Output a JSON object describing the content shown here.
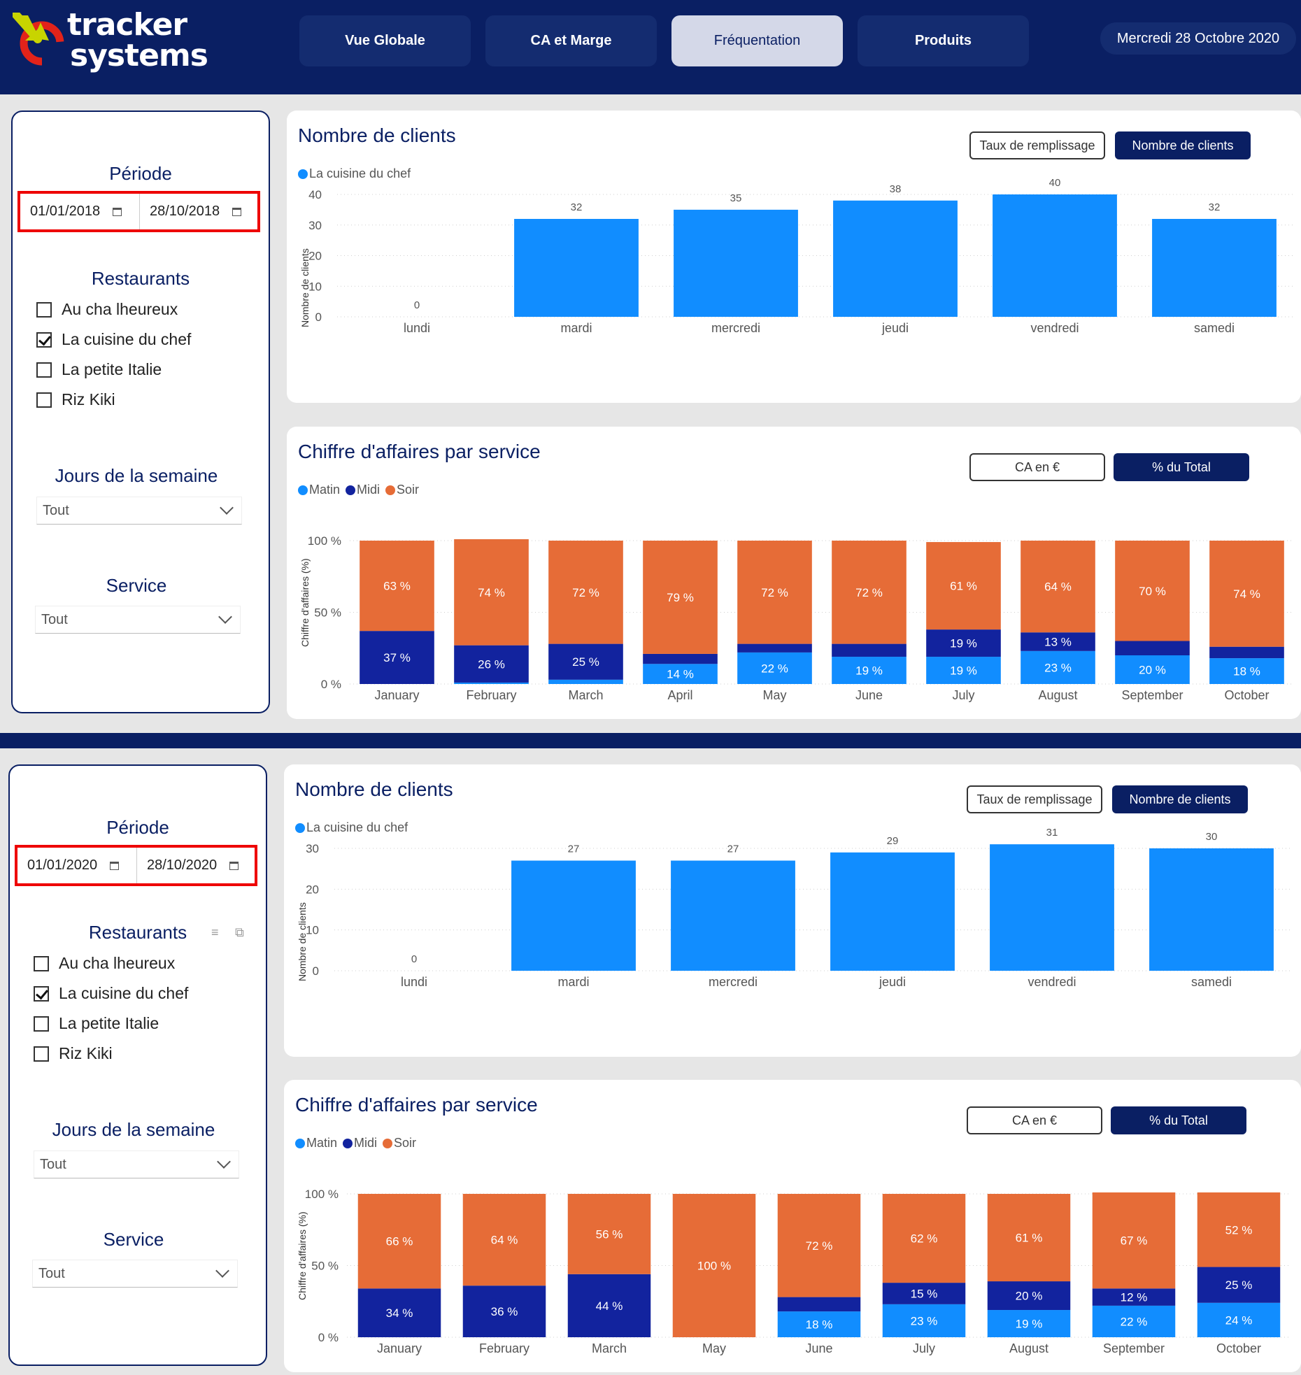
{
  "header": {
    "logo_line1": "tracker",
    "logo_line2": "systems",
    "tabs": [
      {
        "label": "Vue Globale",
        "active": false
      },
      {
        "label": "CA et Marge",
        "active": false
      },
      {
        "label": "Fréquentation",
        "active": true
      },
      {
        "label": "Produits",
        "active": false
      }
    ],
    "date": "Mercredi 28 Octobre 2020"
  },
  "colors": {
    "navy": "#0a1f63",
    "matin": "#118dff",
    "midi": "#12239e",
    "soir": "#e66c37",
    "highlight": "#ee0000"
  },
  "views": [
    {
      "filters": {
        "periode_title": "Période",
        "date_start": "01/01/2018",
        "date_end": "28/10/2018",
        "restaurants_title": "Restaurants",
        "restaurants": [
          {
            "label": "Au cha lheureux",
            "checked": false
          },
          {
            "label": "La cuisine du chef",
            "checked": true
          },
          {
            "label": "La petite Italie",
            "checked": false
          },
          {
            "label": "Riz Kiki",
            "checked": false
          }
        ],
        "jours_title": "Jours de la semaine",
        "jours_value": "Tout",
        "service_title": "Service",
        "service_value": "Tout"
      },
      "clients_panel": {
        "title": "Nombre de clients",
        "btn_taux": "Taux de remplissage",
        "btn_nombre": "Nombre de clients",
        "legend": "La cuisine du chef",
        "ylabel": "Nombre de clients"
      },
      "ca_panel": {
        "title": "Chiffre d'affaires par service",
        "btn_ca": "CA en €",
        "btn_pct": "% du Total",
        "legend": [
          "Matin",
          "Midi",
          "Soir"
        ],
        "ylabel": "Chiffre d'affaires (%)"
      }
    },
    {
      "filters": {
        "periode_title": "Période",
        "date_start": "01/01/2020",
        "date_end": "28/10/2020",
        "restaurants_title": "Restaurants",
        "restaurants": [
          {
            "label": "Au cha lheureux",
            "checked": false
          },
          {
            "label": "La cuisine du chef",
            "checked": true
          },
          {
            "label": "La petite Italie",
            "checked": false
          },
          {
            "label": "Riz Kiki",
            "checked": false
          }
        ],
        "jours_title": "Jours de la semaine",
        "jours_value": "Tout",
        "service_title": "Service",
        "service_value": "Tout"
      },
      "clients_panel": {
        "title": "Nombre de clients",
        "btn_taux": "Taux de remplissage",
        "btn_nombre": "Nombre de clients",
        "legend": "La cuisine du chef",
        "ylabel": "Nombre de clients"
      },
      "ca_panel": {
        "title": "Chiffre d'affaires par service",
        "btn_ca": "CA en €",
        "btn_pct": "% du Total",
        "legend": [
          "Matin",
          "Midi",
          "Soir"
        ],
        "ylabel": "Chiffre d'affaires (%)"
      }
    }
  ],
  "chart_data": [
    {
      "type": "bar",
      "title": "Nombre de clients",
      "ylabel": "Nombre de clients",
      "categories": [
        "lundi",
        "mardi",
        "mercredi",
        "jeudi",
        "vendredi",
        "samedi"
      ],
      "series": [
        {
          "name": "La cuisine du chef",
          "values": [
            0,
            32,
            35,
            38,
            40,
            32
          ]
        }
      ],
      "ylim": [
        0,
        40
      ],
      "yticks": [
        0,
        10,
        20,
        30,
        40
      ]
    },
    {
      "type": "bar",
      "stacked": true,
      "title": "Chiffre d'affaires par service",
      "ylabel": "Chiffre d'affaires (%)",
      "categories": [
        "January",
        "February",
        "March",
        "April",
        "May",
        "June",
        "July",
        "August",
        "September",
        "October"
      ],
      "series": [
        {
          "name": "Matin",
          "values": [
            0,
            1,
            3,
            14,
            22,
            19,
            19,
            23,
            20,
            18
          ]
        },
        {
          "name": "Midi",
          "values": [
            37,
            26,
            25,
            7,
            6,
            9,
            19,
            13,
            10,
            8
          ]
        },
        {
          "name": "Soir",
          "values": [
            63,
            74,
            72,
            79,
            72,
            72,
            61,
            64,
            70,
            74
          ]
        }
      ],
      "labels": {
        "Matin": [
          "",
          "",
          "",
          "14 %",
          "22 %",
          "19 %",
          "19 %",
          "23 %",
          "20 %",
          "18 %"
        ],
        "Midi": [
          "37 %",
          "26 %",
          "25 %",
          "",
          "",
          "",
          "19 %",
          "13 %",
          "",
          ""
        ],
        "Soir": [
          "63 %",
          "74 %",
          "72 %",
          "79 %",
          "72 %",
          "72 %",
          "61 %",
          "64 %",
          "70 %",
          "74 %"
        ]
      },
      "ylim": [
        0,
        100
      ],
      "yticks": [
        "0 %",
        "50 %",
        "100 %"
      ]
    },
    {
      "type": "bar",
      "title": "Nombre de clients",
      "ylabel": "Nombre de clients",
      "categories": [
        "lundi",
        "mardi",
        "mercredi",
        "jeudi",
        "vendredi",
        "samedi"
      ],
      "series": [
        {
          "name": "La cuisine du chef",
          "values": [
            0,
            27,
            27,
            29,
            31,
            30
          ]
        }
      ],
      "ylim": [
        0,
        30
      ],
      "yticks": [
        0,
        10,
        20,
        30
      ]
    },
    {
      "type": "bar",
      "stacked": true,
      "title": "Chiffre d'affaires par service",
      "ylabel": "Chiffre d'affaires (%)",
      "categories": [
        "January",
        "February",
        "March",
        "May",
        "June",
        "July",
        "August",
        "September",
        "October"
      ],
      "series": [
        {
          "name": "Matin",
          "values": [
            0,
            0,
            0,
            0,
            18,
            23,
            19,
            22,
            24
          ]
        },
        {
          "name": "Midi",
          "values": [
            34,
            36,
            44,
            0,
            10,
            15,
            20,
            12,
            25
          ]
        },
        {
          "name": "Soir",
          "values": [
            66,
            64,
            56,
            100,
            72,
            62,
            61,
            67,
            52
          ]
        }
      ],
      "labels": {
        "Matin": [
          "",
          "",
          "",
          "",
          "18 %",
          "23 %",
          "19 %",
          "22 %",
          "24 %"
        ],
        "Midi": [
          "34 %",
          "36 %",
          "44 %",
          "",
          "",
          "15 %",
          "20 %",
          "12 %",
          "25 %"
        ],
        "Soir": [
          "66 %",
          "64 %",
          "56 %",
          "100 %",
          "72 %",
          "62 %",
          "61 %",
          "67 %",
          "52 %"
        ]
      },
      "ylim": [
        0,
        100
      ],
      "yticks": [
        "0 %",
        "50 %",
        "100 %"
      ]
    }
  ]
}
